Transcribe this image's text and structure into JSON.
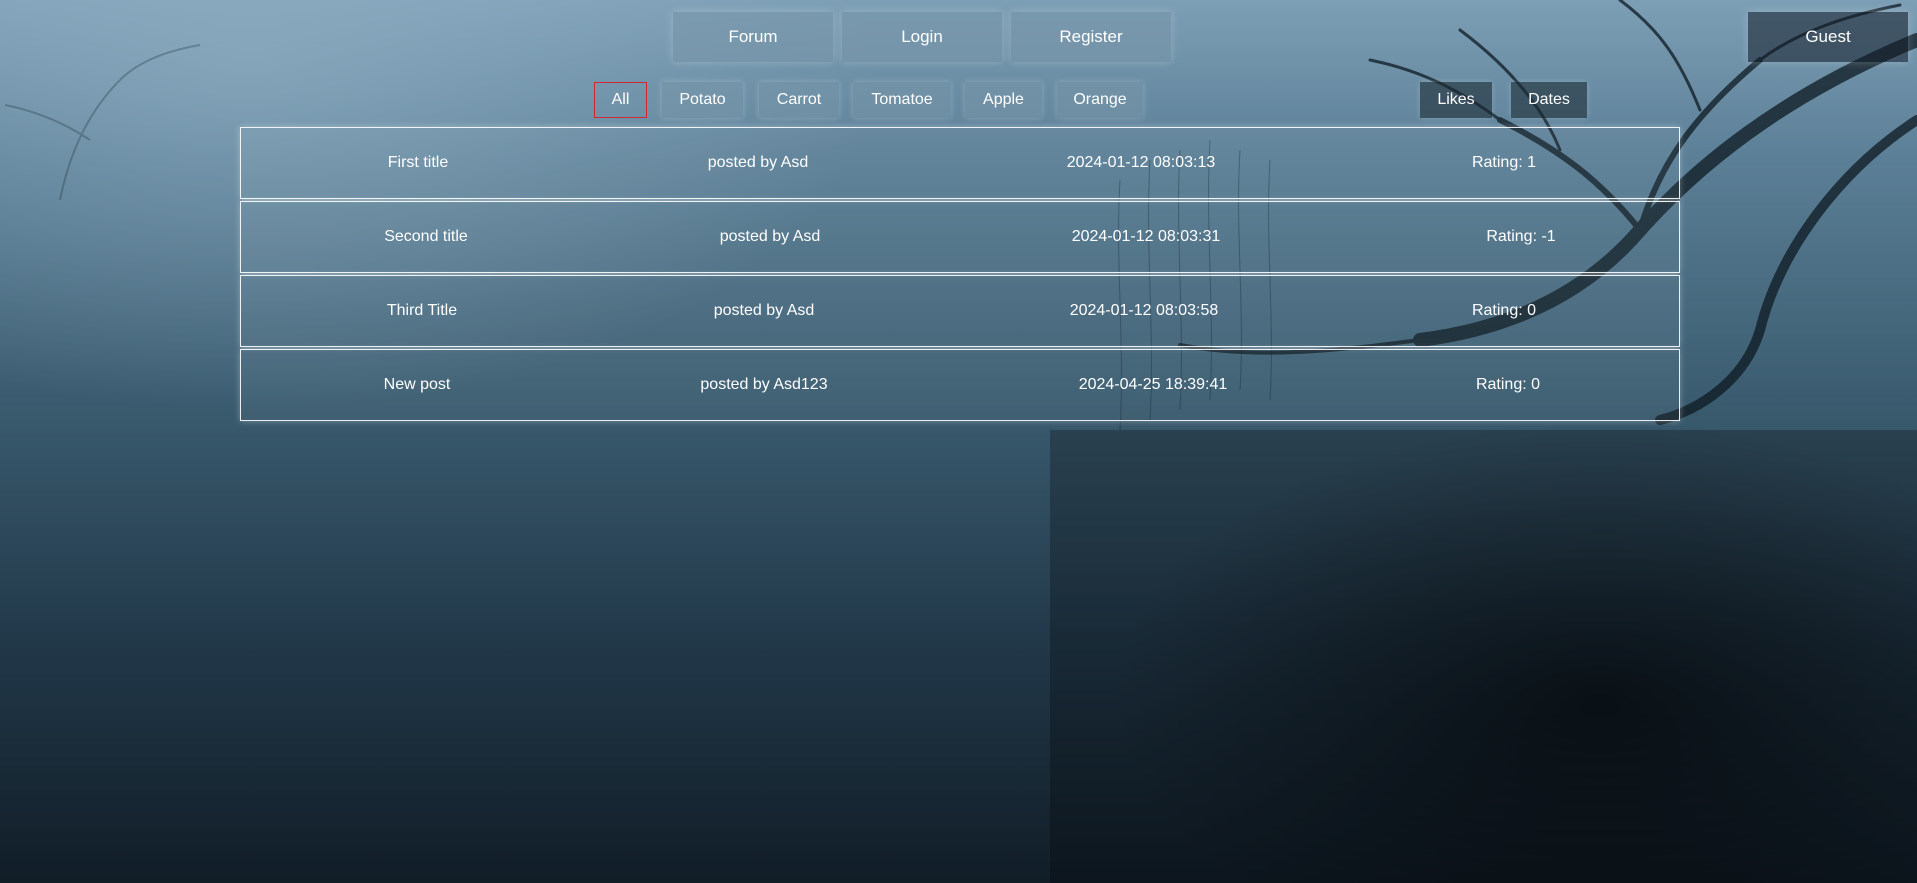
{
  "nav": {
    "forum": "Forum",
    "login": "Login",
    "register": "Register",
    "guest": "Guest"
  },
  "filters": {
    "selected": "All",
    "categories": [
      "All",
      "Potato",
      "Carrot",
      "Tomatoe",
      "Apple",
      "Orange"
    ]
  },
  "sort": {
    "likes": "Likes",
    "dates": "Dates"
  },
  "posts": [
    {
      "title": "First title",
      "author": "posted by Asd",
      "date": "2024-01-12 08:03:13",
      "rating": "Rating: 1"
    },
    {
      "title": "Second title",
      "author": "posted by Asd",
      "date": "2024-01-12 08:03:31",
      "rating": "Rating: -1"
    },
    {
      "title": "Third Title",
      "author": "posted by Asd",
      "date": "2024-01-12 08:03:58",
      "rating": "Rating: 0"
    },
    {
      "title": "New post",
      "author": "posted by Asd123",
      "date": "2024-04-25 18:39:41",
      "rating": "Rating: 0"
    }
  ],
  "colors": {
    "active_filter_border": "#d3272f"
  }
}
